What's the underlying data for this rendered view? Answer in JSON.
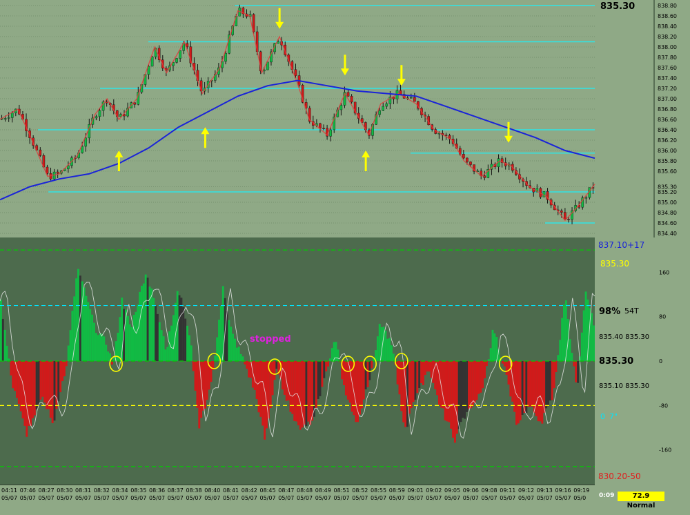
{
  "chart_data": [
    {
      "type": "candlestick",
      "name": "",
      "title": "",
      "ylim": [
        834.4,
        838.8
      ],
      "y_ticks": [
        "838.80",
        "838.60",
        "838.40",
        "838.20",
        "838.00",
        "837.80",
        "837.60",
        "837.40",
        "837.20",
        "837.00",
        "836.80",
        "836.60",
        "836.40",
        "836.20",
        "836.00",
        "835.80",
        "835.60",
        "835.30",
        "835.20",
        "835.00",
        "834.80",
        "834.60",
        "834.40"
      ],
      "last_price_label": "835.30",
      "horizontal_levels": [
        838.8,
        838.1,
        837.2,
        836.4,
        835.95,
        835.2,
        834.6
      ],
      "moving_average": [
        {
          "t": 0,
          "v": 835.05
        },
        {
          "t": 0.05,
          "v": 835.3
        },
        {
          "t": 0.1,
          "v": 835.45
        },
        {
          "t": 0.15,
          "v": 835.55
        },
        {
          "t": 0.2,
          "v": 835.75
        },
        {
          "t": 0.25,
          "v": 836.05
        },
        {
          "t": 0.3,
          "v": 836.45
        },
        {
          "t": 0.35,
          "v": 836.75
        },
        {
          "t": 0.4,
          "v": 837.05
        },
        {
          "t": 0.45,
          "v": 837.25
        },
        {
          "t": 0.5,
          "v": 837.35
        },
        {
          "t": 0.55,
          "v": 837.25
        },
        {
          "t": 0.6,
          "v": 837.15
        },
        {
          "t": 0.65,
          "v": 837.1
        },
        {
          "t": 0.7,
          "v": 837.05
        },
        {
          "t": 0.75,
          "v": 836.85
        },
        {
          "t": 0.8,
          "v": 836.65
        },
        {
          "t": 0.85,
          "v": 836.45
        },
        {
          "t": 0.9,
          "v": 836.25
        },
        {
          "t": 0.95,
          "v": 836.0
        },
        {
          "t": 1.0,
          "v": 835.85
        }
      ],
      "price_path": [
        {
          "t": 0,
          "v": 836.6
        },
        {
          "t": 0.03,
          "v": 836.8
        },
        {
          "t": 0.05,
          "v": 836.3
        },
        {
          "t": 0.08,
          "v": 835.5
        },
        {
          "t": 0.1,
          "v": 835.55
        },
        {
          "t": 0.13,
          "v": 835.9
        },
        {
          "t": 0.16,
          "v": 836.7
        },
        {
          "t": 0.18,
          "v": 837.0
        },
        {
          "t": 0.2,
          "v": 836.6
        },
        {
          "t": 0.23,
          "v": 837.0
        },
        {
          "t": 0.26,
          "v": 838.0
        },
        {
          "t": 0.28,
          "v": 837.5
        },
        {
          "t": 0.31,
          "v": 838.1
        },
        {
          "t": 0.34,
          "v": 837.1
        },
        {
          "t": 0.37,
          "v": 837.6
        },
        {
          "t": 0.4,
          "v": 838.7
        },
        {
          "t": 0.42,
          "v": 838.6
        },
        {
          "t": 0.44,
          "v": 837.5
        },
        {
          "t": 0.47,
          "v": 838.2
        },
        {
          "t": 0.5,
          "v": 837.3
        },
        {
          "t": 0.52,
          "v": 836.6
        },
        {
          "t": 0.55,
          "v": 836.3
        },
        {
          "t": 0.58,
          "v": 837.1
        },
        {
          "t": 0.6,
          "v": 836.7
        },
        {
          "t": 0.62,
          "v": 836.3
        },
        {
          "t": 0.64,
          "v": 836.9
        },
        {
          "t": 0.67,
          "v": 837.1
        },
        {
          "t": 0.7,
          "v": 836.9
        },
        {
          "t": 0.73,
          "v": 836.4
        },
        {
          "t": 0.76,
          "v": 836.2
        },
        {
          "t": 0.78,
          "v": 835.8
        },
        {
          "t": 0.81,
          "v": 835.5
        },
        {
          "t": 0.84,
          "v": 835.8
        },
        {
          "t": 0.86,
          "v": 835.7
        },
        {
          "t": 0.89,
          "v": 835.3
        },
        {
          "t": 0.92,
          "v": 835.1
        },
        {
          "t": 0.95,
          "v": 834.65
        },
        {
          "t": 0.97,
          "v": 834.9
        },
        {
          "t": 1.0,
          "v": 835.35
        }
      ],
      "arrows_up": [
        {
          "t": 0.2,
          "v": 836.0
        },
        {
          "t": 0.345,
          "v": 836.45
        },
        {
          "t": 0.615,
          "v": 836.0
        }
      ],
      "arrows_down": [
        {
          "t": 0.47,
          "v": 838.35
        },
        {
          "t": 0.58,
          "v": 837.45
        },
        {
          "t": 0.675,
          "v": 837.25
        },
        {
          "t": 0.855,
          "v": 836.15
        }
      ]
    },
    {
      "type": "area",
      "name": "",
      "title": "",
      "ylim": [
        -220,
        220
      ],
      "y_ticks": [
        160,
        80,
        0,
        -80,
        -160
      ],
      "reference_lines": [
        {
          "value": 200,
          "color": "#00cc00"
        },
        {
          "value": 100,
          "color": "#00e5ff"
        },
        {
          "value": 0,
          "color": "#00cc00"
        },
        {
          "value": -80,
          "color": "#ffff00"
        },
        {
          "value": -190,
          "color": "#00cc00"
        }
      ],
      "series": [
        {
          "values": [
            {
              "t": 0,
              "v": 120
            },
            {
              "t": 0.02,
              "v": -40
            },
            {
              "t": 0.045,
              "v": -130
            },
            {
              "t": 0.07,
              "v": -60
            },
            {
              "t": 0.09,
              "v": -110
            },
            {
              "t": 0.11,
              "v": -20
            },
            {
              "t": 0.13,
              "v": 170
            },
            {
              "t": 0.16,
              "v": 60
            },
            {
              "t": 0.18,
              "v": 30
            },
            {
              "t": 0.19,
              "v": -10
            },
            {
              "t": 0.205,
              "v": 110
            },
            {
              "t": 0.22,
              "v": 60
            },
            {
              "t": 0.245,
              "v": 160
            },
            {
              "t": 0.265,
              "v": 90
            },
            {
              "t": 0.28,
              "v": 20
            },
            {
              "t": 0.3,
              "v": 130
            },
            {
              "t": 0.32,
              "v": 40
            },
            {
              "t": 0.335,
              "v": -120
            },
            {
              "t": 0.355,
              "v": -40
            },
            {
              "t": 0.375,
              "v": 130
            },
            {
              "t": 0.39,
              "v": 50
            },
            {
              "t": 0.41,
              "v": 0
            },
            {
              "t": 0.43,
              "v": -60
            },
            {
              "t": 0.445,
              "v": -140
            },
            {
              "t": 0.465,
              "v": -20
            },
            {
              "t": 0.48,
              "v": -60
            },
            {
              "t": 0.5,
              "v": -120
            },
            {
              "t": 0.525,
              "v": -110
            },
            {
              "t": 0.545,
              "v": -30
            },
            {
              "t": 0.565,
              "v": 40
            },
            {
              "t": 0.58,
              "v": -60
            },
            {
              "t": 0.6,
              "v": -110
            },
            {
              "t": 0.62,
              "v": -40
            },
            {
              "t": 0.64,
              "v": 70
            },
            {
              "t": 0.66,
              "v": 30
            },
            {
              "t": 0.68,
              "v": -130
            },
            {
              "t": 0.7,
              "v": -60
            },
            {
              "t": 0.72,
              "v": -20
            },
            {
              "t": 0.74,
              "v": -80
            },
            {
              "t": 0.765,
              "v": -140
            },
            {
              "t": 0.79,
              "v": -80
            },
            {
              "t": 0.81,
              "v": -60
            },
            {
              "t": 0.83,
              "v": 60
            },
            {
              "t": 0.85,
              "v": -20
            },
            {
              "t": 0.87,
              "v": -120
            },
            {
              "t": 0.89,
              "v": -80
            },
            {
              "t": 0.91,
              "v": -110
            },
            {
              "t": 0.93,
              "v": -60
            },
            {
              "t": 0.95,
              "v": 120
            },
            {
              "t": 0.97,
              "v": -60
            },
            {
              "t": 0.985,
              "v": 130
            },
            {
              "t": 1.0,
              "v": 60
            }
          ]
        }
      ],
      "circles": [
        {
          "t": 0.195,
          "v": -5
        },
        {
          "t": 0.36,
          "v": 0
        },
        {
          "t": 0.462,
          "v": -10
        },
        {
          "t": 0.585,
          "v": -5
        },
        {
          "t": 0.622,
          "v": -5
        },
        {
          "t": 0.675,
          "v": 0
        },
        {
          "t": 0.85,
          "v": -5
        }
      ],
      "annotation": "stopped"
    }
  ],
  "right_labels": {
    "top_blue": "837.10+17",
    "top_yellow": "835.30",
    "percent": "98%",
    "ticks": "54T",
    "pair_top": "835.40 835.30",
    "center": "835.30",
    "pair_bottom": "835.10 835.30",
    "low_left": "0",
    "low_right": "7\"",
    "bottom_red": "830.20-50"
  },
  "x_axis": {
    "times": [
      "04:11",
      "07:46",
      "08:27",
      "08:30",
      "08:31",
      "08:32",
      "08:34",
      "08:35",
      "08:36",
      "08:37",
      "08:38",
      "08:40",
      "08:41",
      "08:42",
      "08:45",
      "08:47",
      "08:48",
      "08:49",
      "08:51",
      "08:52",
      "08:55",
      "08:59",
      "09:01",
      "09:02",
      "09:05",
      "09:06",
      "09:08",
      "09:11",
      "09:12",
      "09:13",
      "09:16",
      "09:19"
    ],
    "dates": [
      "05/07",
      "05/07",
      "05/07",
      "05/07",
      "05/07",
      "05/07",
      "05/07",
      "05/07",
      "05/07",
      "05/07",
      "05/07",
      "05/07",
      "05/07",
      "05/07",
      "05/07",
      "05/07",
      "05/07",
      "05/07",
      "05/07",
      "05/07",
      "05/07",
      "05/07",
      "05/07",
      "05/07",
      "05/07",
      "05/07",
      "05/07",
      "05/07",
      "05/07",
      "05/07",
      "05/07",
      "05/0"
    ]
  },
  "status": {
    "time": "0:09",
    "mode": "72.9 Normal"
  },
  "colors": {
    "upper_bg": "#8fa986",
    "lower_bg": "#4d6b4d",
    "level_line": "#2ee6e6",
    "ma_line": "#1a23d8",
    "bull": "#11bb44",
    "bear": "#d11a1a",
    "arrow": "#ffff00"
  }
}
